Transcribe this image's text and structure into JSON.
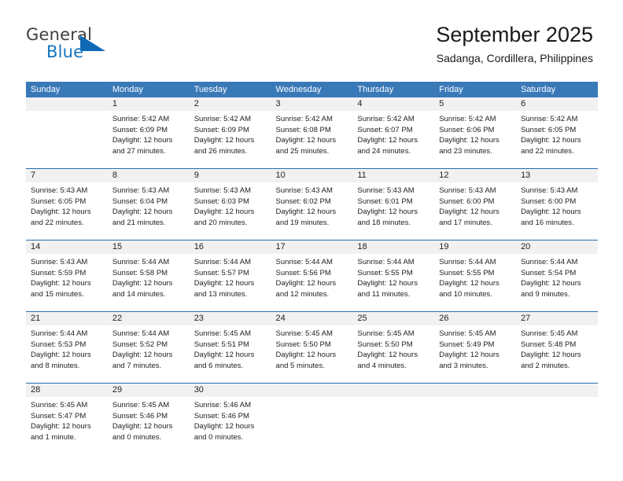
{
  "brand": {
    "name_top": "General",
    "name_bottom": "Blue",
    "accent_color": "#1069b4",
    "top_color": "#3f3f3f"
  },
  "header": {
    "title": "September 2025",
    "subtitle": "Sadanga, Cordillera, Philippines"
  },
  "calendar": {
    "header_bg": "#3a79b8",
    "row_divider_color": "#2a6cb0",
    "daynum_strip_bg": "#f1f1f1",
    "weekday_labels": [
      "Sunday",
      "Monday",
      "Tuesday",
      "Wednesday",
      "Thursday",
      "Friday",
      "Saturday"
    ],
    "weeks": [
      {
        "days": [
          {
            "number": "",
            "sunrise": "",
            "sunset": "",
            "daylight": "",
            "empty": true
          },
          {
            "number": "1",
            "sunrise": "Sunrise: 5:42 AM",
            "sunset": "Sunset: 6:09 PM",
            "daylight": "Daylight: 12 hours and 27 minutes."
          },
          {
            "number": "2",
            "sunrise": "Sunrise: 5:42 AM",
            "sunset": "Sunset: 6:09 PM",
            "daylight": "Daylight: 12 hours and 26 minutes."
          },
          {
            "number": "3",
            "sunrise": "Sunrise: 5:42 AM",
            "sunset": "Sunset: 6:08 PM",
            "daylight": "Daylight: 12 hours and 25 minutes."
          },
          {
            "number": "4",
            "sunrise": "Sunrise: 5:42 AM",
            "sunset": "Sunset: 6:07 PM",
            "daylight": "Daylight: 12 hours and 24 minutes."
          },
          {
            "number": "5",
            "sunrise": "Sunrise: 5:42 AM",
            "sunset": "Sunset: 6:06 PM",
            "daylight": "Daylight: 12 hours and 23 minutes."
          },
          {
            "number": "6",
            "sunrise": "Sunrise: 5:42 AM",
            "sunset": "Sunset: 6:05 PM",
            "daylight": "Daylight: 12 hours and 22 minutes."
          }
        ]
      },
      {
        "days": [
          {
            "number": "7",
            "sunrise": "Sunrise: 5:43 AM",
            "sunset": "Sunset: 6:05 PM",
            "daylight": "Daylight: 12 hours and 22 minutes."
          },
          {
            "number": "8",
            "sunrise": "Sunrise: 5:43 AM",
            "sunset": "Sunset: 6:04 PM",
            "daylight": "Daylight: 12 hours and 21 minutes."
          },
          {
            "number": "9",
            "sunrise": "Sunrise: 5:43 AM",
            "sunset": "Sunset: 6:03 PM",
            "daylight": "Daylight: 12 hours and 20 minutes."
          },
          {
            "number": "10",
            "sunrise": "Sunrise: 5:43 AM",
            "sunset": "Sunset: 6:02 PM",
            "daylight": "Daylight: 12 hours and 19 minutes."
          },
          {
            "number": "11",
            "sunrise": "Sunrise: 5:43 AM",
            "sunset": "Sunset: 6:01 PM",
            "daylight": "Daylight: 12 hours and 18 minutes."
          },
          {
            "number": "12",
            "sunrise": "Sunrise: 5:43 AM",
            "sunset": "Sunset: 6:00 PM",
            "daylight": "Daylight: 12 hours and 17 minutes."
          },
          {
            "number": "13",
            "sunrise": "Sunrise: 5:43 AM",
            "sunset": "Sunset: 6:00 PM",
            "daylight": "Daylight: 12 hours and 16 minutes."
          }
        ]
      },
      {
        "days": [
          {
            "number": "14",
            "sunrise": "Sunrise: 5:43 AM",
            "sunset": "Sunset: 5:59 PM",
            "daylight": "Daylight: 12 hours and 15 minutes."
          },
          {
            "number": "15",
            "sunrise": "Sunrise: 5:44 AM",
            "sunset": "Sunset: 5:58 PM",
            "daylight": "Daylight: 12 hours and 14 minutes."
          },
          {
            "number": "16",
            "sunrise": "Sunrise: 5:44 AM",
            "sunset": "Sunset: 5:57 PM",
            "daylight": "Daylight: 12 hours and 13 minutes."
          },
          {
            "number": "17",
            "sunrise": "Sunrise: 5:44 AM",
            "sunset": "Sunset: 5:56 PM",
            "daylight": "Daylight: 12 hours and 12 minutes."
          },
          {
            "number": "18",
            "sunrise": "Sunrise: 5:44 AM",
            "sunset": "Sunset: 5:55 PM",
            "daylight": "Daylight: 12 hours and 11 minutes."
          },
          {
            "number": "19",
            "sunrise": "Sunrise: 5:44 AM",
            "sunset": "Sunset: 5:55 PM",
            "daylight": "Daylight: 12 hours and 10 minutes."
          },
          {
            "number": "20",
            "sunrise": "Sunrise: 5:44 AM",
            "sunset": "Sunset: 5:54 PM",
            "daylight": "Daylight: 12 hours and 9 minutes."
          }
        ]
      },
      {
        "days": [
          {
            "number": "21",
            "sunrise": "Sunrise: 5:44 AM",
            "sunset": "Sunset: 5:53 PM",
            "daylight": "Daylight: 12 hours and 8 minutes."
          },
          {
            "number": "22",
            "sunrise": "Sunrise: 5:44 AM",
            "sunset": "Sunset: 5:52 PM",
            "daylight": "Daylight: 12 hours and 7 minutes."
          },
          {
            "number": "23",
            "sunrise": "Sunrise: 5:45 AM",
            "sunset": "Sunset: 5:51 PM",
            "daylight": "Daylight: 12 hours and 6 minutes."
          },
          {
            "number": "24",
            "sunrise": "Sunrise: 5:45 AM",
            "sunset": "Sunset: 5:50 PM",
            "daylight": "Daylight: 12 hours and 5 minutes."
          },
          {
            "number": "25",
            "sunrise": "Sunrise: 5:45 AM",
            "sunset": "Sunset: 5:50 PM",
            "daylight": "Daylight: 12 hours and 4 minutes."
          },
          {
            "number": "26",
            "sunrise": "Sunrise: 5:45 AM",
            "sunset": "Sunset: 5:49 PM",
            "daylight": "Daylight: 12 hours and 3 minutes."
          },
          {
            "number": "27",
            "sunrise": "Sunrise: 5:45 AM",
            "sunset": "Sunset: 5:48 PM",
            "daylight": "Daylight: 12 hours and 2 minutes."
          }
        ]
      },
      {
        "days": [
          {
            "number": "28",
            "sunrise": "Sunrise: 5:45 AM",
            "sunset": "Sunset: 5:47 PM",
            "daylight": "Daylight: 12 hours and 1 minute."
          },
          {
            "number": "29",
            "sunrise": "Sunrise: 5:45 AM",
            "sunset": "Sunset: 5:46 PM",
            "daylight": "Daylight: 12 hours and 0 minutes."
          },
          {
            "number": "30",
            "sunrise": "Sunrise: 5:46 AM",
            "sunset": "Sunset: 5:46 PM",
            "daylight": "Daylight: 12 hours and 0 minutes."
          },
          {
            "number": "",
            "sunrise": "",
            "sunset": "",
            "daylight": "",
            "empty": true
          },
          {
            "number": "",
            "sunrise": "",
            "sunset": "",
            "daylight": "",
            "empty": true
          },
          {
            "number": "",
            "sunrise": "",
            "sunset": "",
            "daylight": "",
            "empty": true
          },
          {
            "number": "",
            "sunrise": "",
            "sunset": "",
            "daylight": "",
            "empty": true
          }
        ]
      }
    ]
  }
}
